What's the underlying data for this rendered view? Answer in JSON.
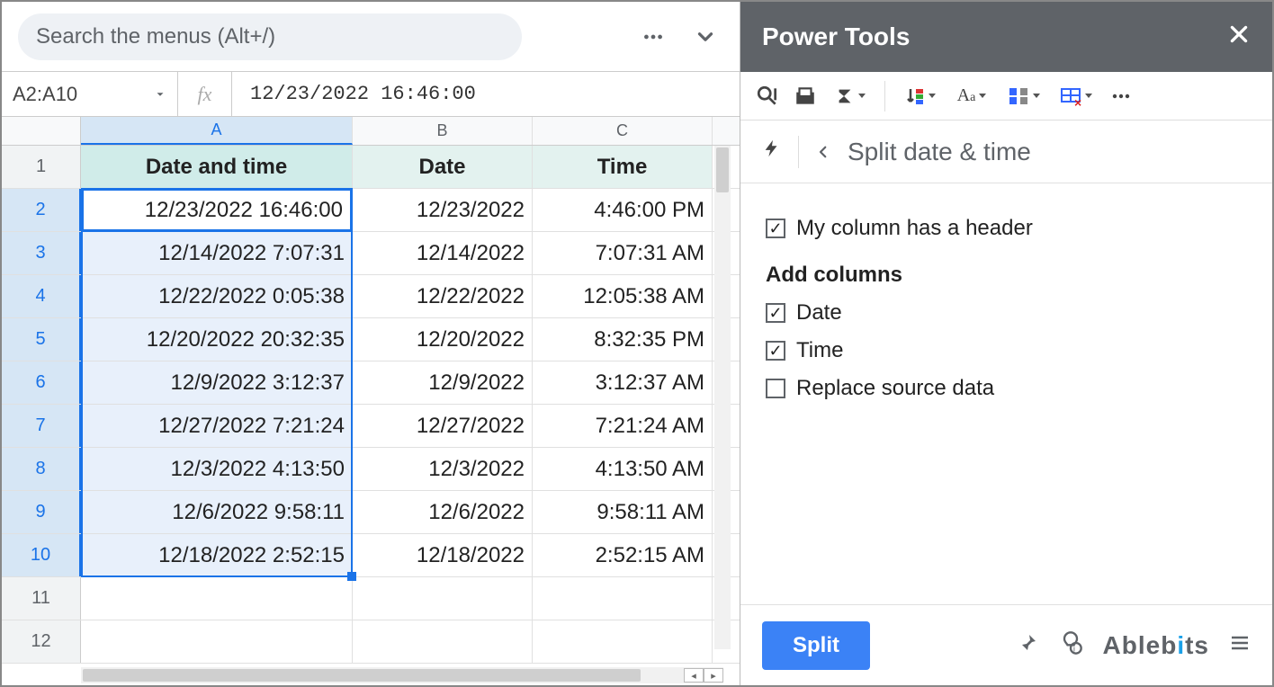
{
  "sheet": {
    "search_placeholder": "Search the menus (Alt+/)",
    "namebox": "A2:A10",
    "formula": "12/23/2022 16:46:00",
    "columns": [
      "A",
      "B",
      "C"
    ],
    "headers": {
      "A": "Date and time",
      "B": "Date",
      "C": "Time"
    },
    "rows": [
      {
        "n": 2,
        "A": "12/23/2022 16:46:00",
        "B": "12/23/2022",
        "C": "4:46:00 PM"
      },
      {
        "n": 3,
        "A": "12/14/2022 7:07:31",
        "B": "12/14/2022",
        "C": "7:07:31 AM"
      },
      {
        "n": 4,
        "A": "12/22/2022 0:05:38",
        "B": "12/22/2022",
        "C": "12:05:38 AM"
      },
      {
        "n": 5,
        "A": "12/20/2022 20:32:35",
        "B": "12/20/2022",
        "C": "8:32:35 PM"
      },
      {
        "n": 6,
        "A": "12/9/2022 3:12:37",
        "B": "12/9/2022",
        "C": "3:12:37 AM"
      },
      {
        "n": 7,
        "A": "12/27/2022 7:21:24",
        "B": "12/27/2022",
        "C": "7:21:24 AM"
      },
      {
        "n": 8,
        "A": "12/3/2022 4:13:50",
        "B": "12/3/2022",
        "C": "4:13:50 AM"
      },
      {
        "n": 9,
        "A": "12/6/2022 9:58:11",
        "B": "12/6/2022",
        "C": "9:58:11 AM"
      },
      {
        "n": 10,
        "A": "12/18/2022 2:52:15",
        "B": "12/18/2022",
        "C": "2:52:15 AM"
      }
    ],
    "empty_rows": [
      11,
      12
    ]
  },
  "panel": {
    "title": "Power Tools",
    "crumb": "Split date & time",
    "header_checkbox": "My column has a header",
    "add_columns": "Add columns",
    "date": "Date",
    "time": "Time",
    "replace": "Replace source data",
    "split_btn": "Split",
    "brand": "Ablebits"
  }
}
